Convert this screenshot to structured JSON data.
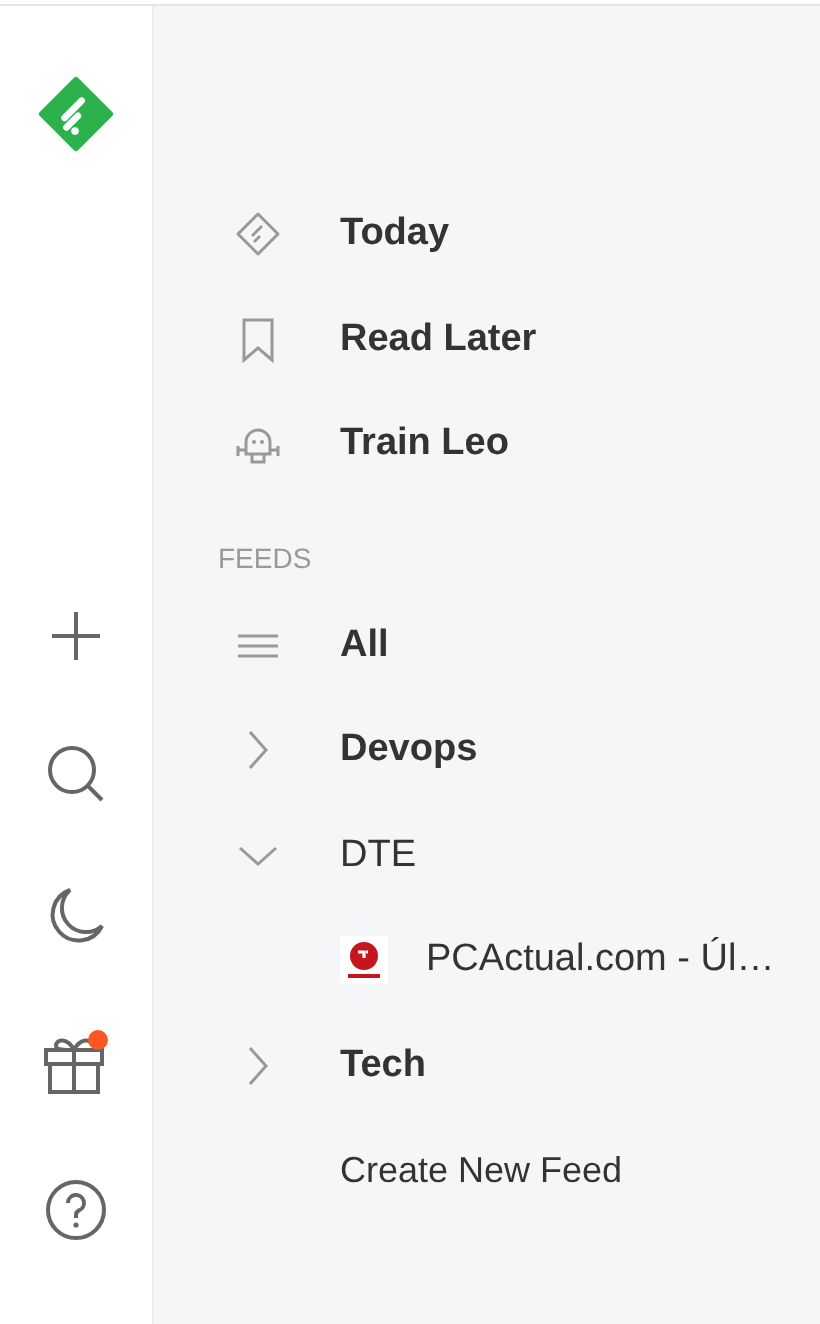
{
  "rail": {
    "gift_notification": true
  },
  "nav": [
    {
      "kind": "today",
      "label": "Today"
    },
    {
      "kind": "later",
      "label": "Read Later"
    },
    {
      "kind": "leo",
      "label": "Train Leo"
    }
  ],
  "feeds_heading": "FEEDS",
  "feeds": [
    {
      "kind": "all",
      "label": "All",
      "unread": true
    },
    {
      "kind": "folder",
      "label": "Devops",
      "unread": true,
      "expanded": false
    },
    {
      "kind": "folder",
      "label": "DTE",
      "unread": false,
      "expanded": true,
      "children": [
        {
          "kind": "feed",
          "label": "PCActual.com - Úl…",
          "unread": false
        }
      ]
    },
    {
      "kind": "folder",
      "label": "Tech",
      "unread": true,
      "expanded": false
    }
  ],
  "create_label": "Create New Feed"
}
